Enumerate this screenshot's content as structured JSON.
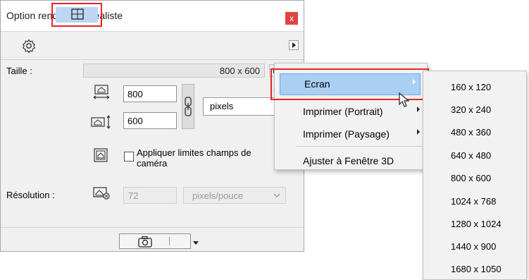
{
  "window": {
    "title": "Option rendu photoréaliste",
    "close_glyph": "x"
  },
  "toolbar": {
    "gear_icon": "gear-icon",
    "size_tab_icon": "frame-size-icon"
  },
  "size": {
    "label": "Taille :",
    "summary": "800 x 600",
    "width": "800",
    "height": "600",
    "unit": "pixels",
    "limit_label_line1": "Appliquer limites champs de",
    "limit_label_line2": "caméra",
    "limit_checked": false
  },
  "resolution": {
    "label": "Résolution :",
    "value": "72",
    "unit": "pixels/pouce"
  },
  "menu": {
    "items": [
      {
        "label": "Ecran",
        "submenu": true,
        "selected": true
      },
      {
        "label": "Imprimer (Portrait)",
        "submenu": true,
        "selected": false
      },
      {
        "label": "Imprimer (Paysage)",
        "submenu": true,
        "selected": false
      },
      {
        "label": "Ajuster à Fenêtre 3D",
        "submenu": false,
        "selected": false
      }
    ]
  },
  "submenu": {
    "items": [
      "160 x 120",
      "320 x 240",
      "480 x 360",
      "640 x 480",
      "800 x 600",
      "1024 x 768",
      "1280 x 1024",
      "1440 x 900",
      "1680 x 1050"
    ]
  },
  "colors": {
    "accent_frame": "#e8232a",
    "selection": "#a9cff5",
    "close": "#e04343"
  }
}
